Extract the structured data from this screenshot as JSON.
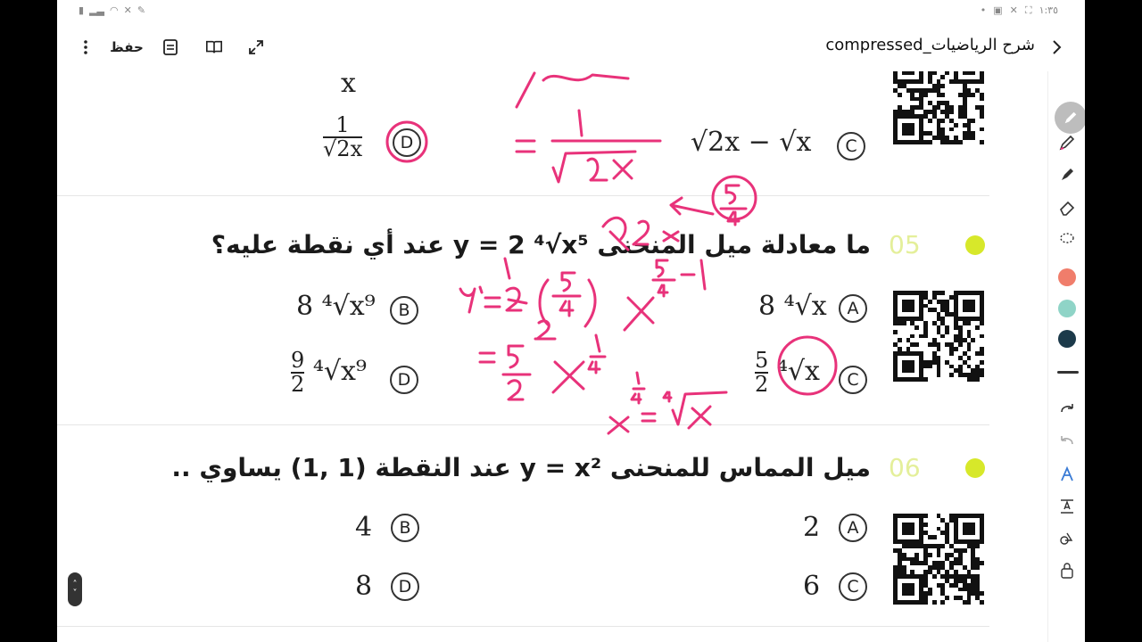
{
  "status_bar": {
    "time": "١:٣٥"
  },
  "toolbar": {
    "save_label": "حفظ",
    "doc_title": "شرح الرياضيات_compressed"
  },
  "questions": [
    {
      "number": "",
      "options": [
        {
          "letter": "C",
          "value": "√2x − √x"
        },
        {
          "letter": "D",
          "num": "1",
          "den": "√2x"
        }
      ],
      "partial_top_value": "x"
    },
    {
      "number": "05",
      "text": "ما معادلة ميل المنحنى y = 2 ⁴√x⁵ عند أي نقطة عليه؟",
      "options": [
        {
          "letter": "A",
          "value": "8 ⁴√x"
        },
        {
          "letter": "B",
          "value": "8 ⁴√x⁹"
        },
        {
          "letter": "C",
          "num": "5",
          "den": "2",
          "rest": "⁴√x"
        },
        {
          "letter": "D",
          "num": "9",
          "den": "2",
          "rest": "⁴√x⁹"
        }
      ]
    },
    {
      "number": "06",
      "text": "ميل المماس للمنحنى y = x² عند النقطة (1 ,1) يساوي ..",
      "options": [
        {
          "letter": "A",
          "value": "2"
        },
        {
          "letter": "B",
          "value": "4"
        },
        {
          "letter": "C",
          "value": "6"
        },
        {
          "letter": "D",
          "value": "8"
        }
      ]
    }
  ],
  "pen_colors": [
    "#f07d6b",
    "#8fd4c7",
    "#1c3a4a"
  ],
  "ink_color": "#e8327a"
}
